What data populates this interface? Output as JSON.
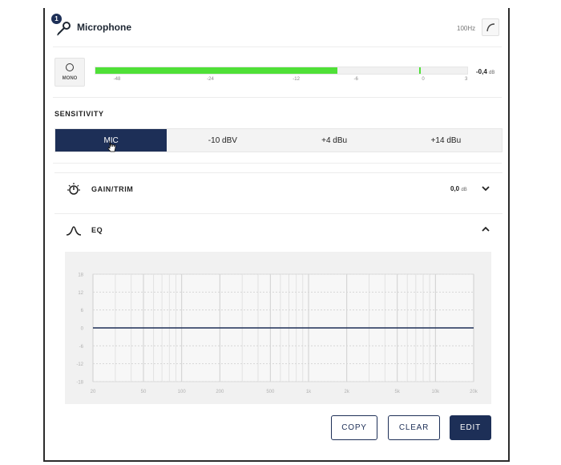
{
  "channel": {
    "number": "1",
    "title": "Microphone",
    "filter_label": "100Hz",
    "filter_icon": "high-pass-filter-icon",
    "mic_icon": "microphone-icon"
  },
  "meter": {
    "mono_label": "MONO",
    "level_fraction": 0.65,
    "peak_db": -0.4,
    "value": "-0,4",
    "unit": "dB",
    "scale": [
      "-48",
      "-24",
      "-12",
      "-6",
      "0",
      "3"
    ],
    "colors": {
      "fill": "#4fe037"
    }
  },
  "sensitivity": {
    "label": "SENSITIVITY",
    "options": [
      "MIC",
      "-10 dBV",
      "+4 dBu",
      "+14 dBu"
    ],
    "selected": "MIC",
    "accent": "#1d2f57"
  },
  "gain": {
    "title": "GAIN/TRIM",
    "value": "0,0",
    "unit": "dB",
    "icon": "gain-knob-icon"
  },
  "eq": {
    "title": "EQ",
    "icon": "bell-curve-icon",
    "buttons": {
      "copy": "COPY",
      "clear": "CLEAR",
      "edit": "EDIT"
    }
  },
  "chart_data": {
    "type": "line",
    "title": "",
    "xlabel": "",
    "ylabel": "",
    "xscale": "log",
    "xlim": [
      20,
      20000
    ],
    "ylim": [
      -18,
      18
    ],
    "x_ticks": [
      "20",
      "50",
      "100",
      "200",
      "500",
      "1k",
      "2k",
      "5k",
      "10k",
      "20k"
    ],
    "y_ticks": [
      "18",
      "12",
      "6",
      "0",
      "-6",
      "-12",
      "-18"
    ],
    "grid": true,
    "series": [
      {
        "x": [
          20,
          20000
        ],
        "y": [
          0,
          0
        ],
        "color": "#1d2f57"
      }
    ]
  }
}
